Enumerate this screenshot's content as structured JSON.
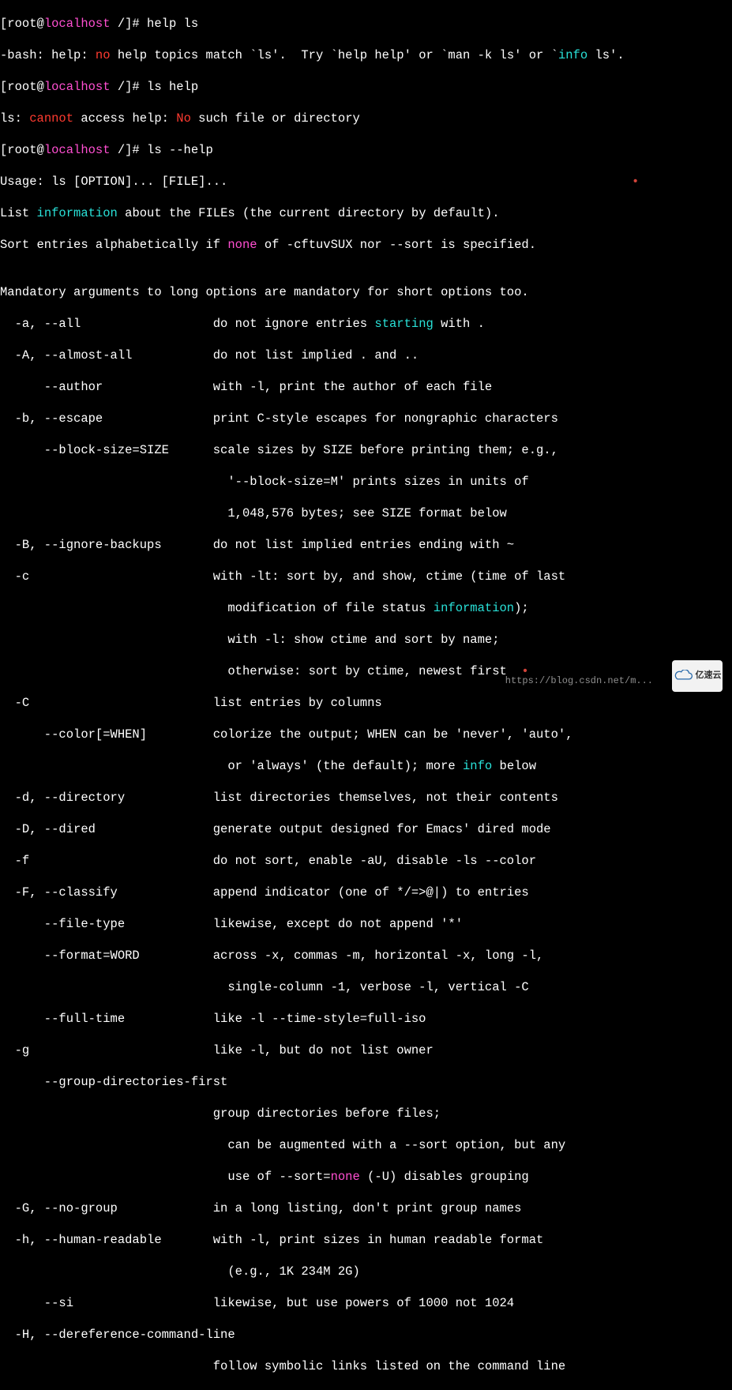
{
  "prompt1": "[root@localhost /]# ",
  "cmd1": "help ls",
  "resp1a": "-bash: help: ",
  "resp1b": "no",
  "resp1c": " help topics match `ls'.  Try `help help' or `man -k ls' or `",
  "resp1d": "info",
  "resp1e": " ls'.",
  "prompt2": "[root@localhost /]# ",
  "cmd2": "ls help",
  "resp2a": "ls: ",
  "resp2b": "cannot",
  "resp2c": " access help: ",
  "resp2d": "No",
  "resp2e": " such file or directory",
  "prompt3": "[root@localhost /]# ",
  "cmd3": "ls --help",
  "usage": "Usage: ls [OPTION]... [FILE]...",
  "dot1": "•",
  "desc1a": "List ",
  "desc1b": "information",
  "desc1c": " about the FILEs (the current directory by default).",
  "desc2a": "Sort entries alphabetically if ",
  "desc2b": "none",
  "desc2c": " of -cftuvSUX nor --sort is specified.",
  "blank": "",
  "mand": "Mandatory arguments to long options are mandatory for short options too.",
  "opt_a": "  -a, --all                  do not ignore entries ",
  "opt_a_kw": "starting",
  "opt_a_end": " with .",
  "opt_A": "  -A, --almost-all           do not list implied . and ..",
  "opt_author": "      --author               with -l, print the author of each file",
  "opt_b": "  -b, --escape               print C-style escapes for nongraphic characters",
  "opt_block1": "      --block-size=SIZE      scale sizes by SIZE before printing them; e.g.,",
  "opt_block2": "                               '--block-size=M' prints sizes in units of",
  "opt_block3": "                               1,048,576 bytes; see SIZE format below",
  "opt_B": "  -B, --ignore-backups       do not list implied entries ending with ~",
  "opt_c1": "  -c                         with -lt: sort by, and show, ctime (time of last",
  "opt_c2a": "                               modification of file status ",
  "opt_c2b": "information",
  "opt_c2c": ");",
  "opt_c3": "                               with -l: show ctime and sort by name;",
  "opt_c4": "                               otherwise: sort by ctime, newest first  ",
  "dot2": "•",
  "opt_C": "  -C                         list entries by columns",
  "opt_color1": "      --color[=WHEN]         colorize the output; WHEN can be 'never', 'auto',",
  "opt_color2a": "                               or 'always' (the default); more ",
  "opt_color2b": "info",
  "opt_color2c": " below",
  "opt_d": "  -d, --directory            list directories themselves, not their contents",
  "opt_D": "  -D, --dired                generate output designed for Emacs' dired mode",
  "opt_f": "  -f                         do not sort, enable -aU, disable -ls --color",
  "opt_F": "  -F, --classify             append indicator (one of */=>@|) to entries",
  "opt_ft": "      --file-type            likewise, except do not append '*'",
  "opt_fmt1": "      --format=WORD          across -x, commas -m, horizontal -x, long -l,",
  "opt_fmt2": "                               single-column -1, verbose -l, vertical -C",
  "opt_full": "      --full-time            like -l --time-style=full-iso",
  "opt_g": "  -g                         like -l, but do not list owner",
  "opt_gdf1": "      --group-directories-first",
  "opt_gdf2": "                             group directories before files;",
  "opt_gdf3": "                               can be augmented with a --sort option, but any",
  "opt_gdf4a": "                               use of --sort=",
  "opt_gdf4b": "none",
  "opt_gdf4c": " (-U) disables grouping",
  "opt_G": "  -G, --no-group             in a long listing, don't print group names",
  "opt_h1": "  -h, --human-readable       with -l, print sizes in human readable format",
  "opt_h2": "                               (e.g., 1K 234M 2G)",
  "opt_si": "      --si                   likewise, but use powers of 1000 not 1024",
  "opt_H1": "  -H, --dereference-command-line",
  "opt_H2": "                             follow symbolic links listed on the command line",
  "watermark_url": "https://blog.csdn.net/m...",
  "watermark_brand": "亿速云"
}
